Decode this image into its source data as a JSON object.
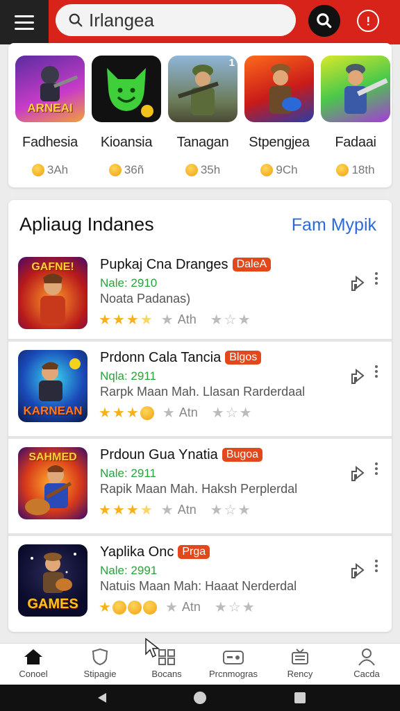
{
  "search": {
    "value": "Irlangea"
  },
  "top_apps": [
    {
      "name": "Fadhesia",
      "meta": "3Ah",
      "thumb_text": "ARNEAI"
    },
    {
      "name": "Kioansia",
      "meta": "36ñ"
    },
    {
      "name": "Tanagan",
      "meta": "35h"
    },
    {
      "name": "Stpengjea",
      "meta": "9Ch"
    },
    {
      "name": "Fadaai",
      "meta": "18th"
    }
  ],
  "top_badge": "1",
  "section": {
    "title": "Apliaug Indanes",
    "link": "Fam Mypik"
  },
  "list": [
    {
      "title": "Pupkaj Cna Dranges",
      "tag": "DaleA",
      "rating": "Nale: 2910",
      "desc": "Noata Padanas)",
      "label": "Ath",
      "icon_text": "GAFNE!"
    },
    {
      "title": "Prdonn Cala Tancia",
      "tag": "Blgos",
      "rating": "Nqla: 2911",
      "desc": "Rarpk Maan Mah. Llasan Rarderdaal",
      "label": "Atn",
      "icon_text": "KARNEAN"
    },
    {
      "title": "Prdoun Gua Ynatia",
      "tag": "Bugoa",
      "rating": "Nale: 2911",
      "desc": "Rapik Maan Mah. Haksh Perplerdal",
      "label": "Atn",
      "icon_text": "SAHMED"
    },
    {
      "title": "Yaplika Onc",
      "tag": "Prga",
      "rating": "Nale: 2991",
      "desc": "Natuis Maan Mah: Haaat Nerderdal",
      "label": "Atn",
      "icon_text": "GAMES"
    }
  ],
  "nav": [
    {
      "label": "Conoel"
    },
    {
      "label": "Stipagie"
    },
    {
      "label": "Bocans"
    },
    {
      "label": "Prcnmogras"
    },
    {
      "label": "Rency"
    },
    {
      "label": "Cacda"
    }
  ],
  "colors": {
    "brand": "#d8231a",
    "link": "#2c6ad8",
    "rating": "#27a33a",
    "tag": "#e2481a",
    "star": "#f5b21b"
  }
}
